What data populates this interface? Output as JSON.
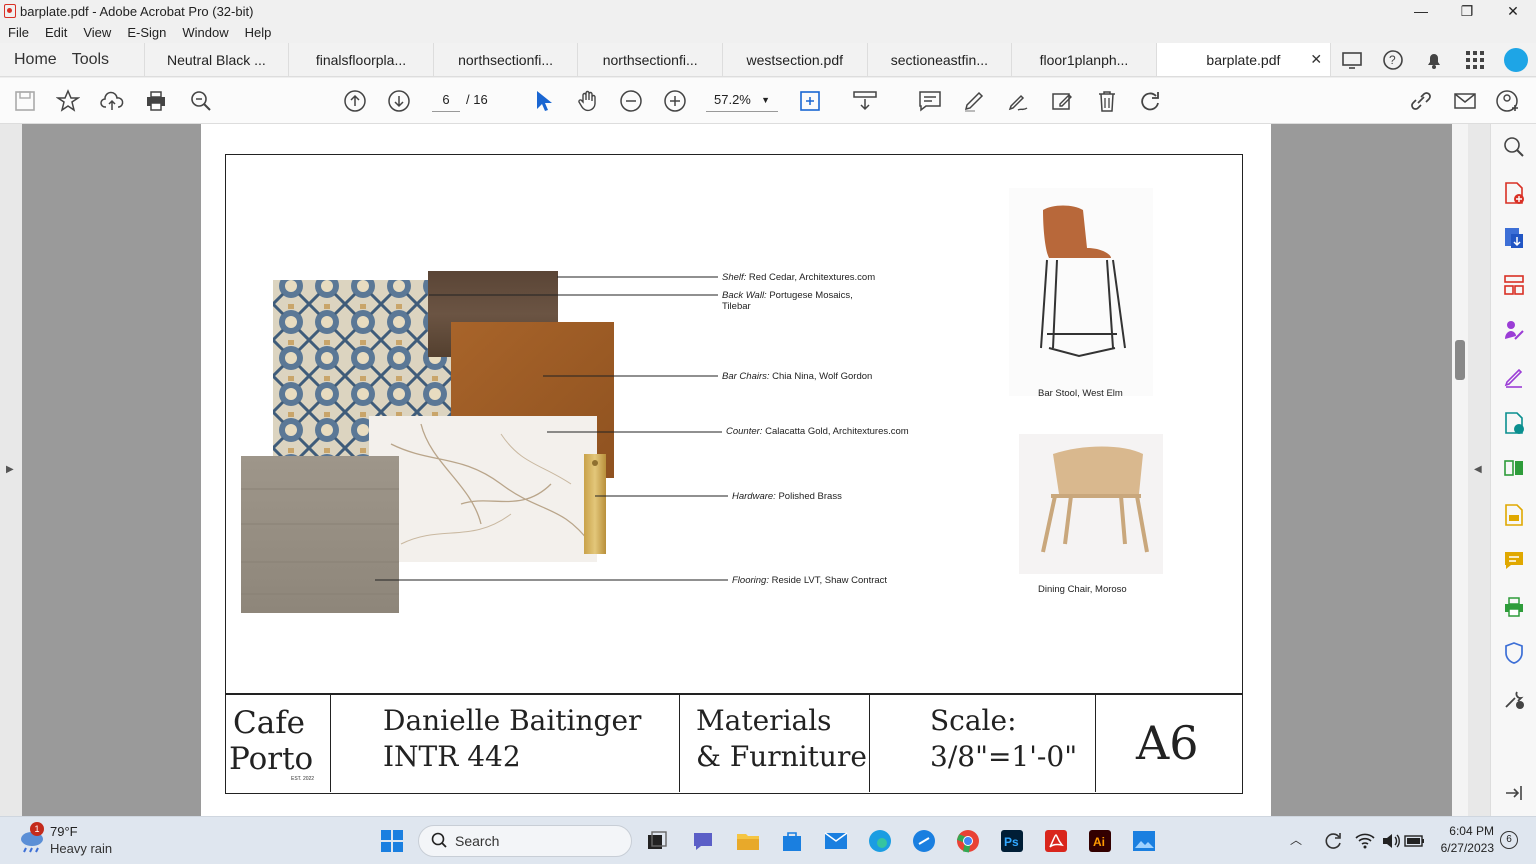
{
  "window": {
    "title": "barplate.pdf - Adobe Acrobat Pro (32-bit)",
    "minimize": "—",
    "maximize": "❐",
    "close": "✕"
  },
  "menu": [
    "File",
    "Edit",
    "View",
    "E-Sign",
    "Window",
    "Help"
  ],
  "nav": {
    "home": "Home",
    "tools": "Tools"
  },
  "tabs": [
    {
      "label": "Neutral Black ..."
    },
    {
      "label": "finalsfloorpla..."
    },
    {
      "label": "northsectionfi..."
    },
    {
      "label": "northsectionfi..."
    },
    {
      "label": "westsection.pdf"
    },
    {
      "label": "sectioneastfin..."
    },
    {
      "label": "floor1planph..."
    },
    {
      "label": "barplate.pdf",
      "active": true
    }
  ],
  "toolbar": {
    "page_current": "6",
    "page_total": "/ 16",
    "zoom": "57.2%"
  },
  "document": {
    "labels": [
      {
        "italic": "Shelf:",
        "text": " Red Cedar, Architextures.com"
      },
      {
        "italic": "Back Wall:",
        "text": " Portugese Mosaics,",
        "line2": "Tilebar"
      },
      {
        "italic": "Bar Chairs:",
        "text": " Chia Nina, Wolf Gordon"
      },
      {
        "italic": "Counter:",
        "text": " Calacatta Gold, Architextures.com"
      },
      {
        "italic": "Hardware:",
        "text": " Polished Brass"
      },
      {
        "italic": "Flooring:",
        "text": " Reside LVT, Shaw Contract"
      }
    ],
    "furniture": {
      "stool_caption": "Bar Stool, West Elm",
      "chair_caption": "Dining Chair, Moroso"
    },
    "titleblock": {
      "logo_line1": "Cafe",
      "logo_line2": "Porto",
      "logo_est": "EST. 2022",
      "name": "Danielle Baitinger",
      "course": "INTR 442",
      "subject_line1": "Materials",
      "subject_line2": "& Furniture",
      "scale_label": "Scale:",
      "scale_value": "3/8\"=1'-0\"",
      "sheet": "A6"
    }
  },
  "taskbar": {
    "weather_temp": "79°F",
    "weather_desc": "Heavy rain",
    "weather_badge": "1",
    "search_placeholder": "Search",
    "time": "6:04 PM",
    "date": "6/27/2023",
    "notif_count": "6"
  }
}
